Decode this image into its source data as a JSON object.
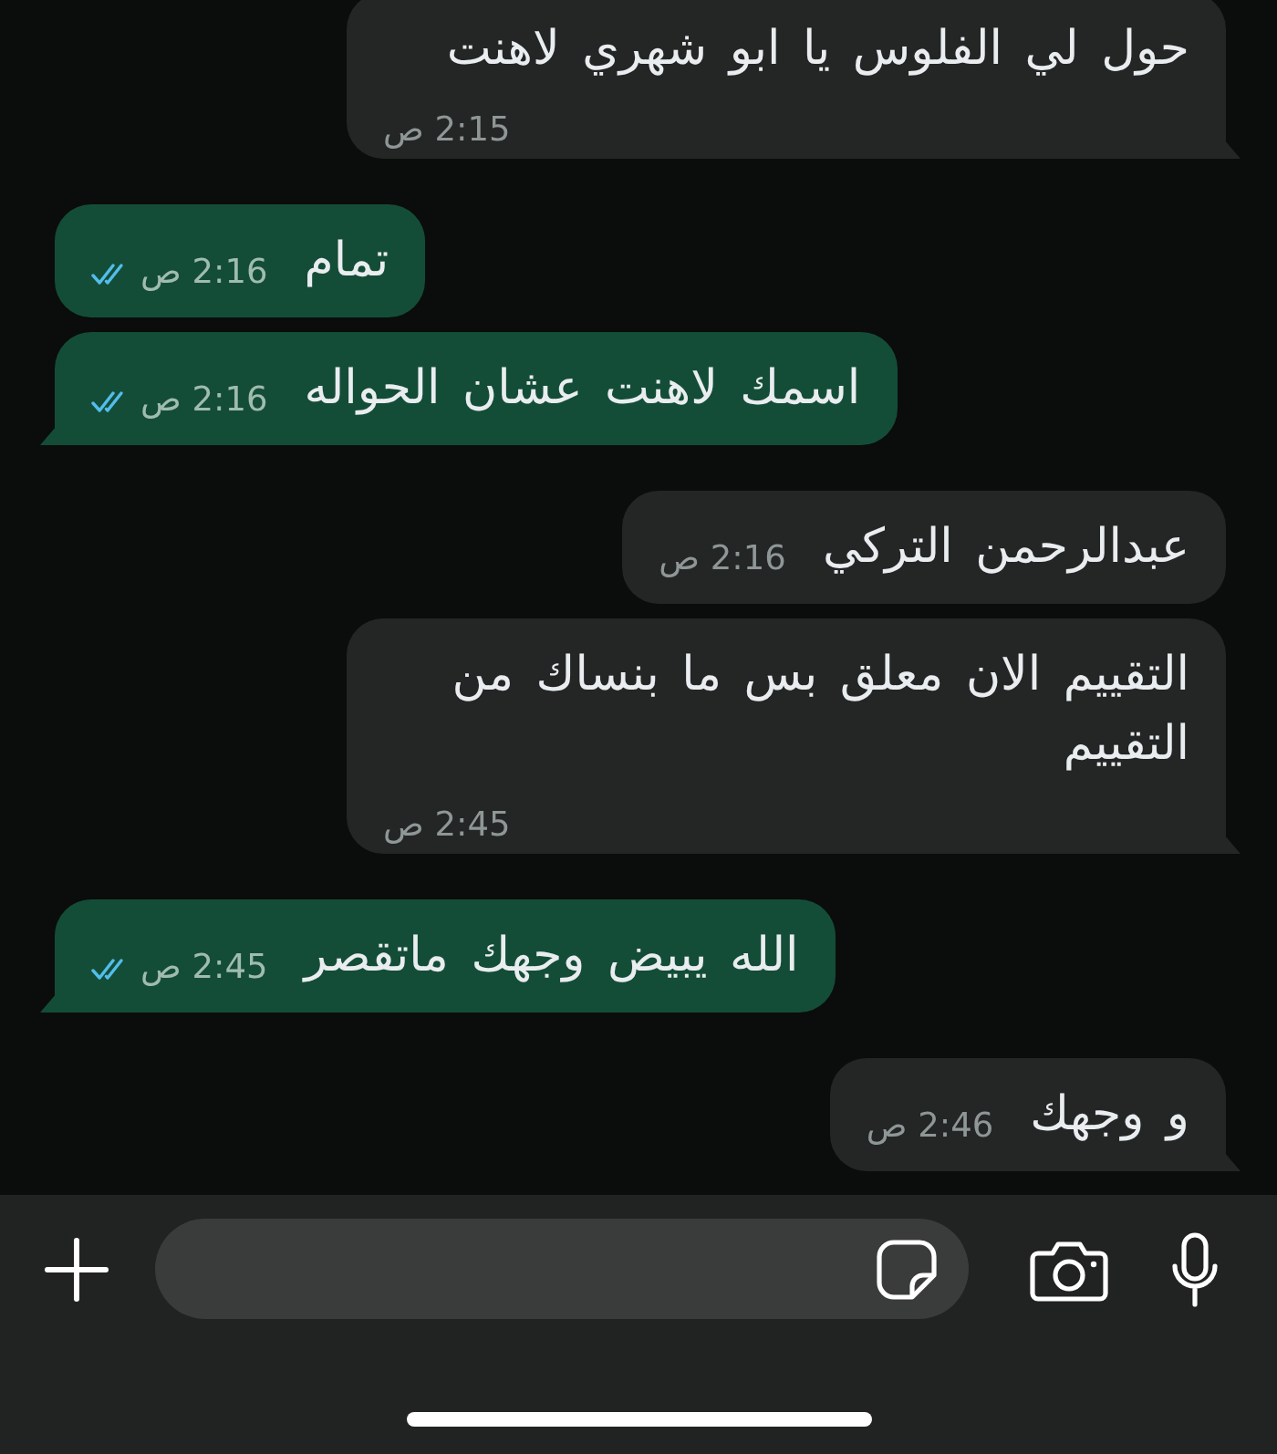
{
  "messages": [
    {
      "kind": "incoming",
      "text": "حول لي الفلوس يا ابو شهري لاهنت",
      "time": "2:15 ص"
    },
    {
      "kind": "outgoing",
      "text": "تمام",
      "time": "2:16 ص",
      "read": true
    },
    {
      "kind": "outgoing",
      "text": "اسمك لاهنت عشان الحواله",
      "time": "2:16 ص",
      "read": true
    },
    {
      "kind": "incoming",
      "text": "عبدالرحمن التركي",
      "time": "2:16 ص"
    },
    {
      "kind": "incoming",
      "text": "التقييم الان معلق بس ما بنساك من التقييم",
      "time": "2:45 ص"
    },
    {
      "kind": "outgoing",
      "text": "الله يبيض وجهك ماتقصر",
      "time": "2:45 ص",
      "read": true
    },
    {
      "kind": "incoming",
      "text": "و وجهك",
      "time": "2:46 ص"
    }
  ]
}
